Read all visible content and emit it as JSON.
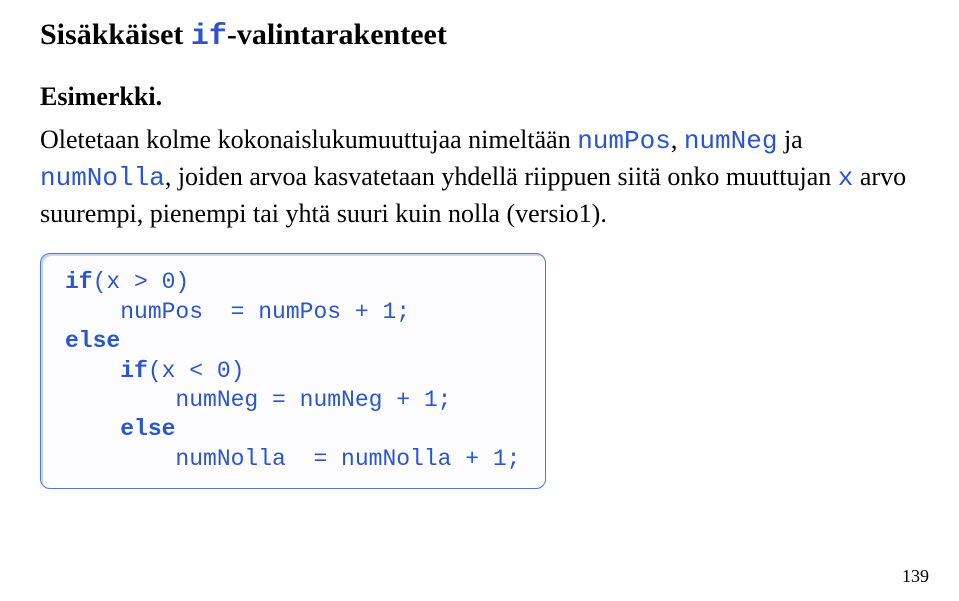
{
  "title": {
    "plain1": "Sisäkkäiset ",
    "mono": "if",
    "plain2": "-valintarakenteet"
  },
  "example_label": "Esimerkki.",
  "body": {
    "part1": "Oletetaan kolme kokonaislukumuuttujaa nimeltään ",
    "m1": "numPos",
    "sep1": ", ",
    "m2": "numNeg",
    "mid1": " ja ",
    "m3": "numNolla",
    "mid2": ", joiden arvoa kasvatetaan yhdellä riippuen siitä onko muuttujan ",
    "m4": "x",
    "tail": " arvo suurempi, pienempi tai yhtä suuri kuin nolla (versio1)."
  },
  "code": {
    "l1_kw": "if",
    "l1_rest": "(x > 0)",
    "l2": "    numPos  = numPos + 1;",
    "l3": "else",
    "l4_indent": "    ",
    "l4_kw": "if",
    "l4_rest": "(x < 0)",
    "l5": "        numNeg = numNeg + 1;",
    "l6_indent": "    ",
    "l6_kw": "else",
    "l7": "        numNolla  = numNolla + 1;"
  },
  "page_number": "139"
}
